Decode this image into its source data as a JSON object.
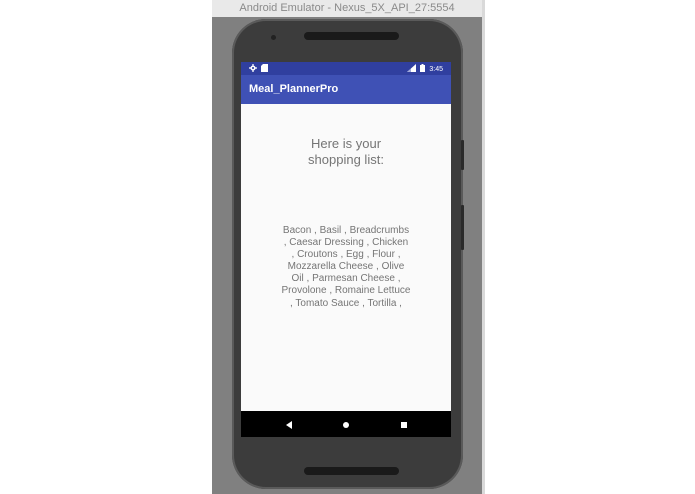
{
  "emulator": {
    "window_title": "Android Emulator - Nexus_5X_API_27:5554"
  },
  "status_bar": {
    "time": "3:45",
    "icons_left": [
      "gear-icon",
      "sd-card-icon"
    ],
    "icons_right": [
      "signal-icon",
      "battery-icon"
    ]
  },
  "app_bar": {
    "title": "Meal_PlannerPro",
    "color": "#3f51b5"
  },
  "content": {
    "heading": "Here is your\nshopping list:",
    "list_text": "Bacon , Basil , Breadcrumbs , Caesar Dressing , Chicken , Croutons , Egg , Flour , Mozzarella Cheese , Olive Oil , Parmesan Cheese , Provolone , Romaine Lettuce , Tomato Sauce , Tortilla ,"
  },
  "nav_bar": {
    "icons": [
      "back-icon",
      "home-icon",
      "recents-icon"
    ]
  },
  "colors": {
    "status_bar": "#303f9f",
    "text_gray": "#757575",
    "screen_bg": "#fafafa"
  }
}
